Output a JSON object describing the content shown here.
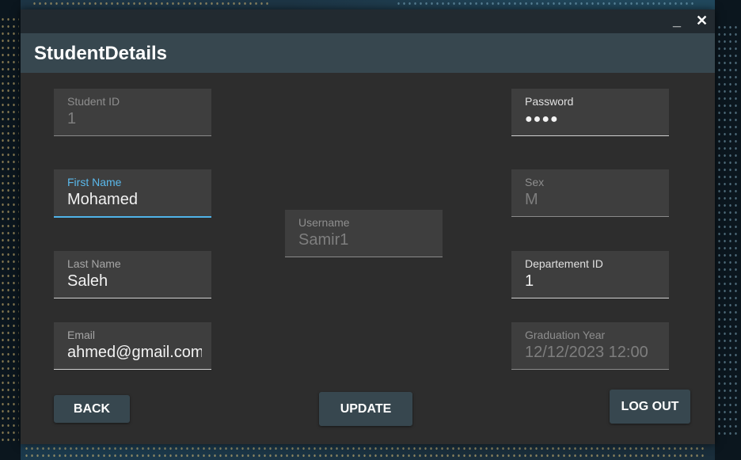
{
  "window": {
    "minimize_glyph": "_",
    "close_glyph": "✕"
  },
  "header": {
    "title": "StudentDetails"
  },
  "fields": {
    "student_id": {
      "label": "Student ID",
      "value": "1"
    },
    "first_name": {
      "label": "First Name",
      "value": "Mohamed"
    },
    "last_name": {
      "label": "Last Name",
      "value": "Saleh"
    },
    "email": {
      "label": "Email",
      "value": "ahmed@gmail.com"
    },
    "username": {
      "label": "Username",
      "value": "Samir1"
    },
    "password": {
      "label": "Password",
      "masked": "●●●●"
    },
    "sex": {
      "label": "Sex",
      "value": "M"
    },
    "department_id": {
      "label": "Departement ID",
      "value": "1"
    },
    "graduation_year": {
      "label": "Graduation Year",
      "value": "12/12/2023 12:00"
    }
  },
  "buttons": {
    "back": "BACK",
    "update": "UPDATE",
    "logout": "LOG OUT"
  },
  "colors": {
    "accent": "#4fb3e8",
    "header": "#37474f",
    "panel": "#2d2d2d"
  }
}
